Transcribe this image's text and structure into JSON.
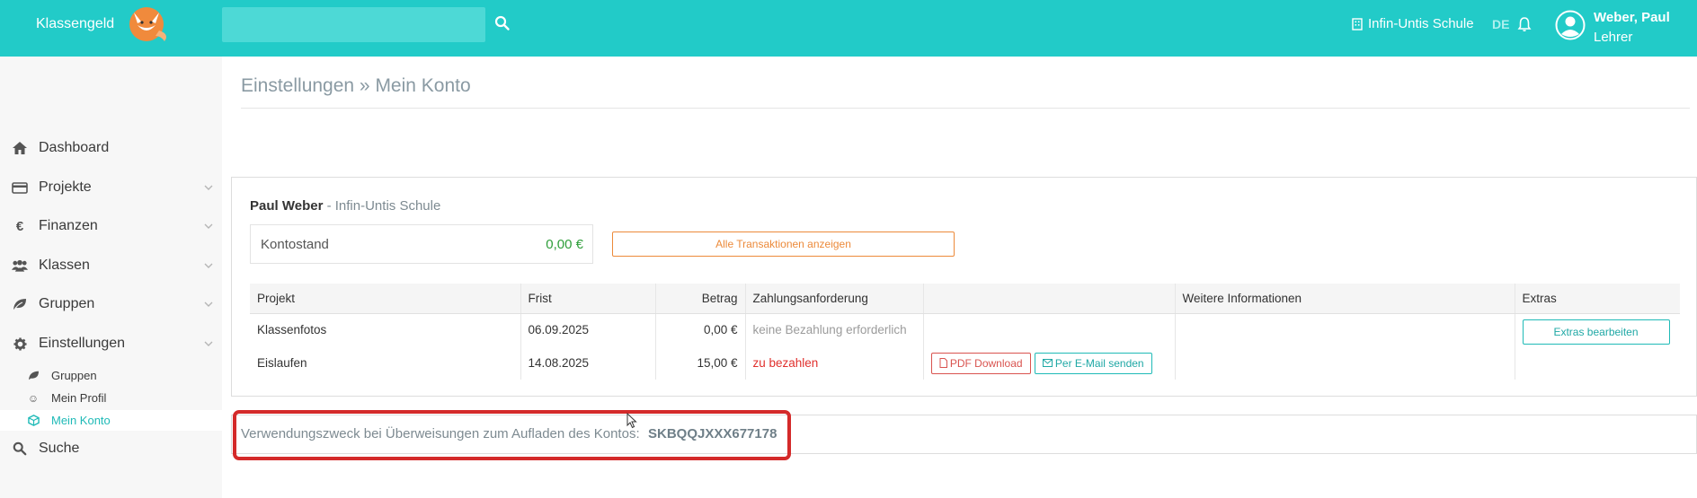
{
  "header": {
    "brand": "Klassengeld",
    "search_placeholder": "",
    "school": "Infin-Untis Schule",
    "language": "DE",
    "user_name": "Weber, Paul",
    "user_role": "Lehrer"
  },
  "sidebar": {
    "items": [
      {
        "label": "Dashboard",
        "icon": "home-icon"
      },
      {
        "label": "Projekte",
        "icon": "credit-card-icon"
      },
      {
        "label": "Finanzen",
        "icon": "euro-icon"
      },
      {
        "label": "Klassen",
        "icon": "users-icon"
      },
      {
        "label": "Gruppen",
        "icon": "leaf-icon"
      },
      {
        "label": "Einstellungen",
        "icon": "gear-icon"
      }
    ],
    "subitems": [
      {
        "label": "Gruppen",
        "icon": "leaf-icon"
      },
      {
        "label": "Mein Profil",
        "icon": "smiley-icon"
      },
      {
        "label": "Mein Konto",
        "icon": "cube-icon"
      }
    ],
    "search_label": "Suche"
  },
  "page": {
    "title": "Einstellungen » Mein Konto"
  },
  "account": {
    "owner_name": "Paul Weber",
    "owner_school": " - Infin-Untis Schule",
    "balance_label": "Kontostand",
    "balance_value": "0,00 €",
    "all_transactions_button": "Alle Transaktionen anzeigen"
  },
  "table": {
    "headers": [
      "Projekt",
      "Frist",
      "Betrag",
      "Zahlungsanforderung",
      "",
      "Weitere Informationen",
      "Extras"
    ],
    "rows": [
      {
        "projekt": "Klassenfotos",
        "frist": "06.09.2025",
        "betrag": "0,00 €",
        "anforderung": "keine Bezahlung erforderlich"
      },
      {
        "projekt": "Eislaufen",
        "frist": "14.08.2025",
        "betrag": "15,00 €",
        "anforderung": "zu bezahlen"
      }
    ],
    "pdf_button": "PDF Download",
    "email_button": "Per E-Mail senden",
    "extras_button": "Extras bearbeiten"
  },
  "reference": {
    "label": "Verwendungszweck bei Überweisungen zum Aufladen des Kontos:",
    "code": "SKBQQJXXX677178"
  },
  "colors": {
    "header": "#22cbc8",
    "accent": "#1fbab7",
    "orange": "#ec8a3a",
    "danger": "#d42a2a",
    "success": "#2e9e3a"
  }
}
